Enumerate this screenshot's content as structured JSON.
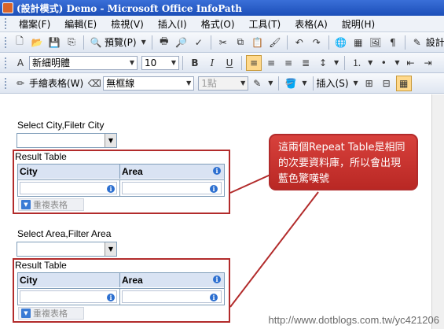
{
  "window": {
    "title": "(設計模式) Demo - Microsoft Office InfoPath"
  },
  "menu": [
    "檔案(F)",
    "編輯(E)",
    "檢視(V)",
    "插入(I)",
    "格式(O)",
    "工具(T)",
    "表格(A)",
    "說明(H)"
  ],
  "toolbar_standard": {
    "preview_label": "預覽(P)",
    "design_tasks_label": "設計工作"
  },
  "toolbar_format": {
    "font_name": "新細明體",
    "font_size": "10"
  },
  "toolbar_table": {
    "draw_table_label": "手繪表格(W)",
    "border_style": "無框線",
    "border_width": "1點",
    "insert_label": "插入(S)"
  },
  "form": {
    "label1": "Select City,Filetr City",
    "section1_title": "Result Table",
    "table1_headers": [
      "City",
      "Area"
    ],
    "label2": "Select Area,Filter Area",
    "section2_title": "Result Table",
    "table2_headers": [
      "City",
      "Area"
    ],
    "repeat_label": "重複表格"
  },
  "callout": {
    "text": "這兩個Repeat Table是相同的次要資料庫，所以會出現藍色驚嘆號"
  },
  "watermark": "http://www.dotblogs.com.tw/yc421206",
  "colors": {
    "title_bar": "#1c4fb8",
    "annotation_red": "#b22b2b",
    "callout_fill": "#c8302b",
    "info_icon": "#2c6fd0"
  }
}
